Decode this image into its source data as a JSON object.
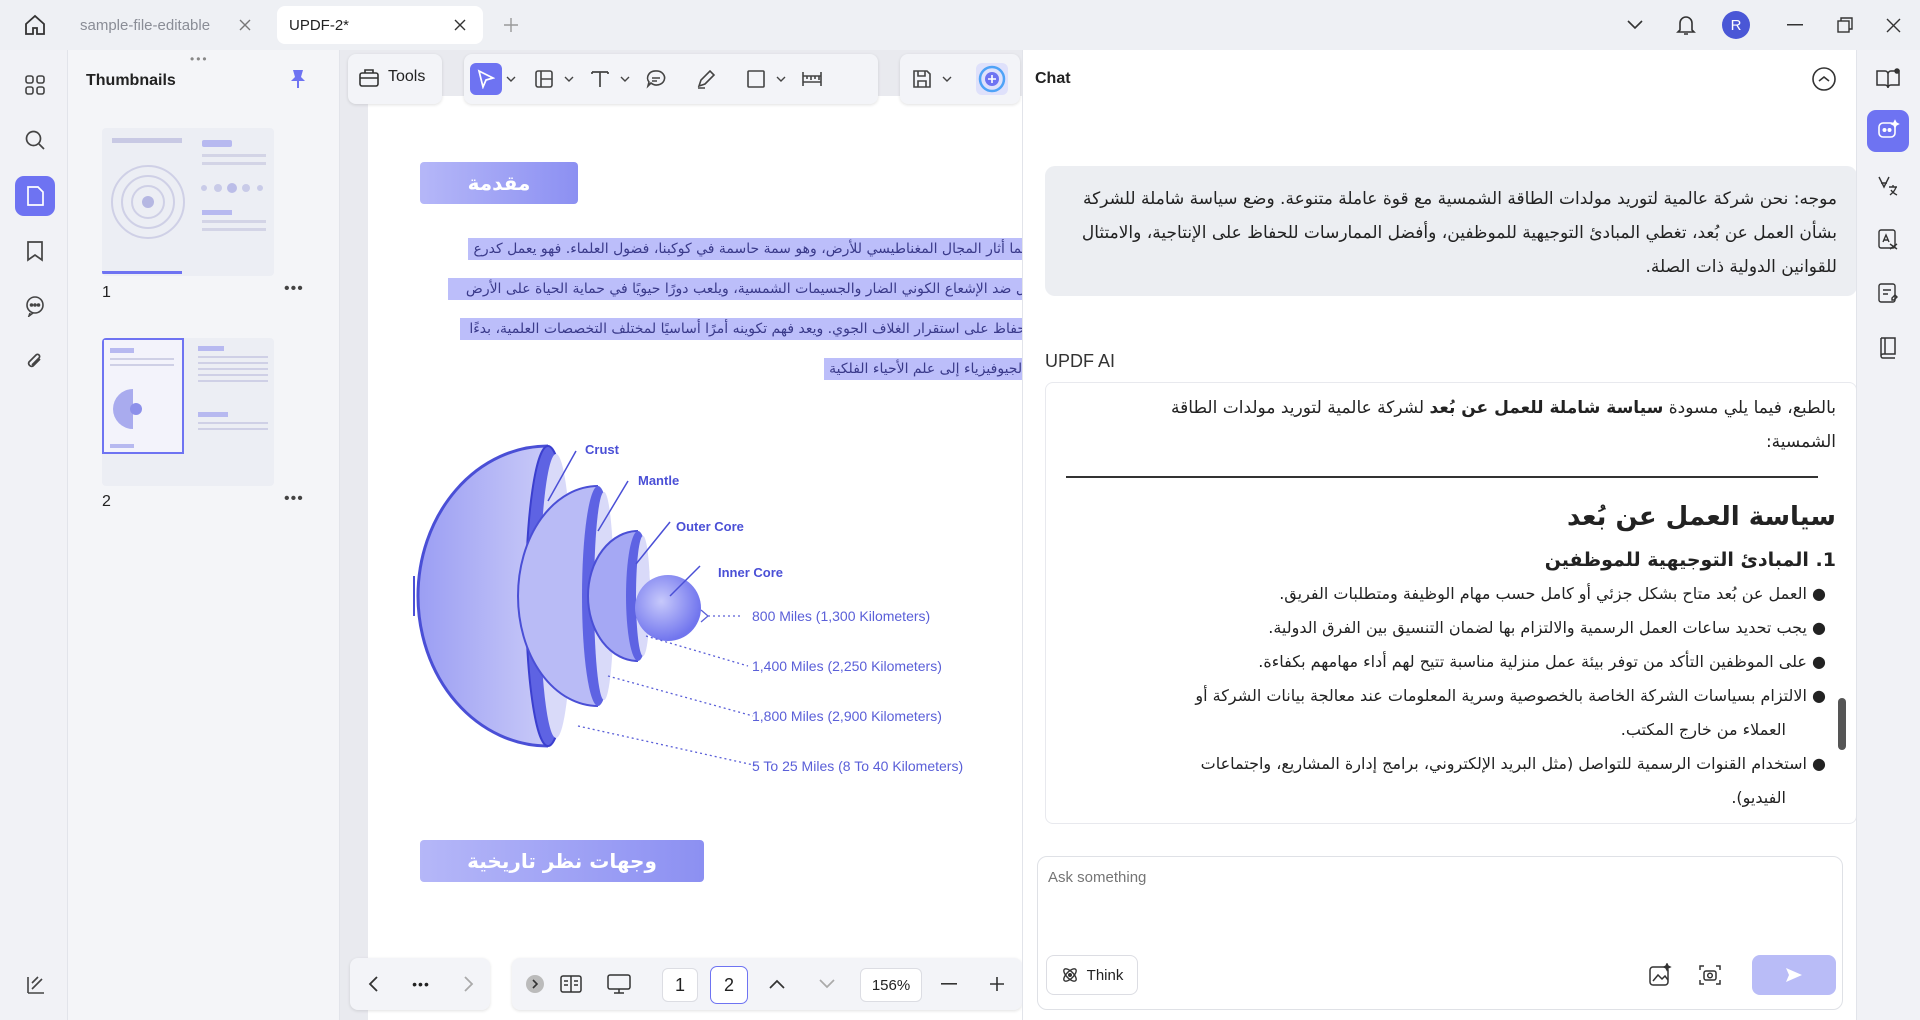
{
  "tabs": [
    {
      "label": "sample-file-editable",
      "active": false
    },
    {
      "label": "UPDF-2*",
      "active": true
    }
  ],
  "user_avatar": "R",
  "thumbnails": {
    "title": "Thumbnails",
    "pages": [
      {
        "num": "1"
      },
      {
        "num": "2"
      }
    ]
  },
  "toolbar": {
    "tools_label": "Tools"
  },
  "document": {
    "heading1": "مقدمة",
    "paragraph_lines": [
      "لما أثار المجال المغناطيسي للأرض، وهو سمة حاسمة في كوكبنا، فضول العلماء. فهو يعمل كدرع",
      "ل ضد الإشعاع الكوني الضار والجسيمات الشمسية، ويلعب دورًا حيويًا في حماية الحياة على الأرض",
      "حفاظ على استقرار الغلاف الجوي. ويعد فهم تكوينه أمرًا أساسيًا لمختلف التخصصات العلمية، بدءًا",
      "الجيوفيزياء إلى علم الأحياء الفلكية"
    ],
    "diagram_labels": {
      "crust": "Crust",
      "mantle": "Mantle",
      "outer_core": "Outer Core",
      "inner_core": "Inner Core"
    },
    "distances": [
      "800 Miles (1,300 Kilometers)",
      "1,400 Miles (2,250 Kilometers)",
      "1,800 Miles (2,900 Kilometers)",
      "5 To 25 Miles (8 To 40 Kilometers)"
    ],
    "heading2": "وجهات نظر تاريخية"
  },
  "bottombar": {
    "page_a": "1",
    "page_b": "2",
    "zoom": "156%"
  },
  "chat": {
    "title": "Chat",
    "user_message": "موجه: نحن شركة عالمية لتوريد مولدات الطاقة الشمسية مع قوة عاملة متنوعة. وضع سياسة شاملة للشركة بشأن العمل عن بُعد، تغطي المبادئ التوجيهية للموظفين، وأفضل الممارسات للحفاظ على الإنتاجية، والامتثال للقوانين الدولية ذات الصلة.",
    "ai_label": "UPDF AI",
    "ai_intro_pre": "بالطبع، فيما يلي مسودة ",
    "ai_intro_bold": "سياسة شاملة للعمل عن بُعد",
    "ai_intro_post": " لشركة عالمية لتوريد مولدات الطاقة الشمسية:",
    "ai_heading": "سياسة العمل عن بُعد",
    "ai_subheading": "1. المبادئ التوجيهية للموظفين",
    "bullets": [
      "العمل عن بُعد متاح بشكل جزئي أو كامل حسب مهام الوظيفة ومتطلبات الفريق.",
      "يجب تحديد ساعات العمل الرسمية والالتزام بها لضمان التنسيق بين الفرق الدولية.",
      "على الموظفين التأكد من توفر بيئة عمل منزلية مناسبة تتيح لهم أداء مهامهم بكفاءة.",
      "الالتزام بسياسات الشركة الخاصة بالخصوصية وسرية المعلومات عند معالجة بيانات الشركة أو",
      "استخدام القنوات الرسمية للتواصل (مثل البريد الإلكتروني، برامج إدارة المشاريع، واجتماعات"
    ],
    "bullet_continuations": [
      "العملاء من خارج المكتب.",
      "الفيديو)."
    ],
    "input_placeholder": "Ask something",
    "think_label": "Think"
  },
  "colors": {
    "accent": "#6e73f2",
    "selection": "#bcbefa",
    "diagram": "#5a5fd8"
  }
}
